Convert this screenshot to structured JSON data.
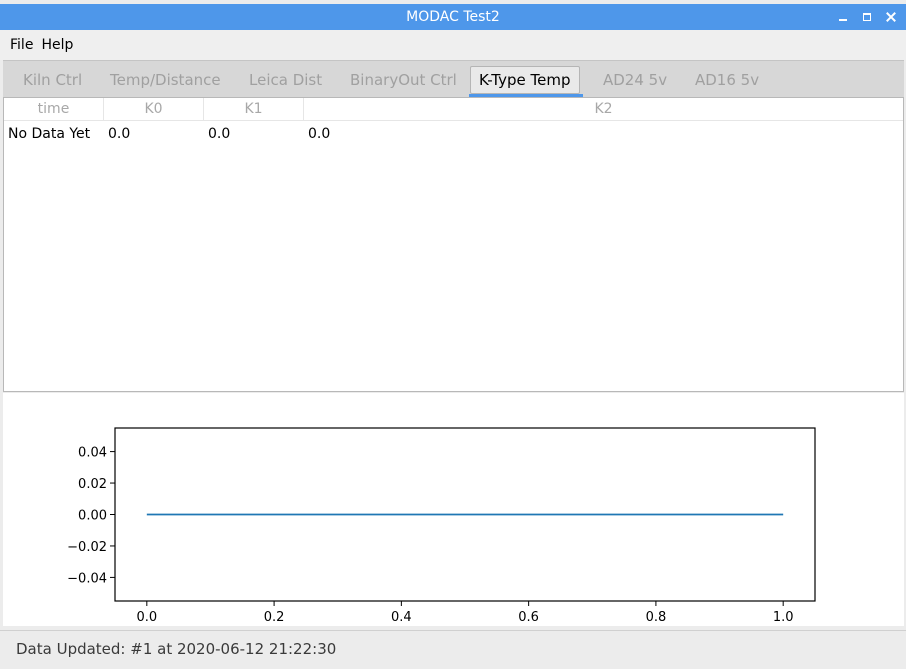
{
  "window": {
    "title": "MODAC Test2"
  },
  "menu": {
    "file": "File",
    "help": "Help"
  },
  "tabs": [
    {
      "label": "Kiln Ctrl"
    },
    {
      "label": "Temp/Distance"
    },
    {
      "label": "Leica Dist"
    },
    {
      "label": "BinaryOut Ctrl"
    },
    {
      "label": "K-Type Temp",
      "active": true
    },
    {
      "label": "AD24 5v"
    },
    {
      "label": "AD16 5v"
    }
  ],
  "table": {
    "columns": [
      "time",
      "K0",
      "K1",
      "K2"
    ],
    "rows": [
      [
        "No Data Yet",
        "0.0",
        "0.0",
        "0.0"
      ]
    ]
  },
  "chart_data": {
    "type": "line",
    "series": [
      {
        "x": [
          0.0,
          1.0
        ],
        "y": [
          0.0,
          0.0
        ],
        "color": "#1f77b4"
      }
    ],
    "xlim": [
      -0.05,
      1.05
    ],
    "ylim": [
      -0.055,
      0.055
    ],
    "xticks": [
      "0.0",
      "0.2",
      "0.4",
      "0.6",
      "0.8",
      "1.0"
    ],
    "yticks": [
      "0.04",
      "0.02",
      "0.00",
      "−0.02",
      "−0.04"
    ],
    "xtick_values": [
      0.0,
      0.2,
      0.4,
      0.6,
      0.8,
      1.0
    ],
    "ytick_values": [
      0.04,
      0.02,
      0.0,
      -0.02,
      -0.04
    ],
    "grid": false
  },
  "status": {
    "text": "Data Updated: #1 at 2020-06-12 21:22:30"
  },
  "colors": {
    "titlebar": "#4e97ea",
    "accent": "#4e97ea",
    "line": "#1f77b4"
  }
}
